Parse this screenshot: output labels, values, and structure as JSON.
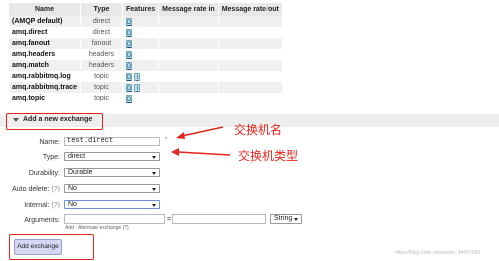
{
  "table": {
    "headers": [
      "Name",
      "Type",
      "Features",
      "Message rate in",
      "Message rate out"
    ],
    "plus_minus": "+/-",
    "rows": [
      {
        "name": "(AMQP default)",
        "type": "direct",
        "features": [
          "D"
        ]
      },
      {
        "name": "amq.direct",
        "type": "direct",
        "features": [
          "D"
        ]
      },
      {
        "name": "amq.fanout",
        "type": "fanout",
        "features": [
          "D"
        ]
      },
      {
        "name": "amq.headers",
        "type": "headers",
        "features": [
          "D"
        ]
      },
      {
        "name": "amq.match",
        "type": "headers",
        "features": [
          "D"
        ]
      },
      {
        "name": "amq.rabbitmq.log",
        "type": "topic",
        "features": [
          "D",
          "I"
        ]
      },
      {
        "name": "amq.rabbitmq.trace",
        "type": "topic",
        "features": [
          "D",
          "I"
        ]
      },
      {
        "name": "amq.topic",
        "type": "topic",
        "features": [
          "D"
        ]
      }
    ]
  },
  "section": {
    "title": "Add a new exchange"
  },
  "form": {
    "name_label": "Name:",
    "name_value": "test.direct",
    "required_mark": "*",
    "type_label": "Type:",
    "type_value": "direct",
    "durability_label": "Durability:",
    "durability_value": "Durable",
    "auto_delete_label": "Auto delete:",
    "auto_delete_help": "(?)",
    "auto_delete_value": "No",
    "internal_label": "Internal:",
    "internal_help": "(?)",
    "internal_value": "No",
    "arguments_label": "Arguments:",
    "arguments_key": "",
    "arguments_eq": "=",
    "arguments_value": "",
    "arguments_type": "String",
    "add_link": "Add",
    "alt_exchange": "Alternate exchange",
    "alt_help": "(?)",
    "submit_label": "Add exchange"
  },
  "annotations": {
    "name_note": "交换机名",
    "type_note": "交换机类型",
    "color": "#e2261c"
  },
  "watermark": "https://blog.csdn.net/weixin_44497080"
}
